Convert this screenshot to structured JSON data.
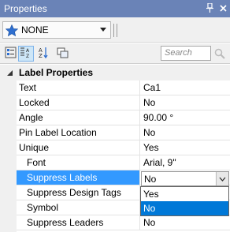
{
  "panel": {
    "title": "Properties",
    "pin_icon": "pin-icon",
    "close_icon": "close-icon"
  },
  "selector": {
    "value": "NONE",
    "icon": "star-icon"
  },
  "toolbar": {
    "search_placeholder": "Search",
    "buttons": [
      "categorized-view-icon",
      "alphabetical-sort-icon",
      "property-pages-icon"
    ]
  },
  "grid": {
    "category": "Label Properties",
    "rows": [
      {
        "name": "Text",
        "value": "Ca1"
      },
      {
        "name": "Locked",
        "value": "No"
      },
      {
        "name": "Angle",
        "value": "90.00 °"
      },
      {
        "name": "Pin Label Location",
        "value": "No"
      },
      {
        "name": "Unique",
        "value": "Yes"
      },
      {
        "name": "Font",
        "value": "Arial, 9\""
      },
      {
        "name": "Suppress Labels",
        "value": "No"
      },
      {
        "name": "Suppress Design Tags",
        "value": ""
      },
      {
        "name": "Symbol",
        "value": ""
      },
      {
        "name": "Suppress Leaders",
        "value": "No"
      }
    ]
  },
  "dropdown": {
    "options": [
      "Yes",
      "No"
    ],
    "selected": "No"
  },
  "colors": {
    "titlebar": "#6a83b7",
    "selection": "#3399ff",
    "dropdown_selection": "#0078d7"
  }
}
